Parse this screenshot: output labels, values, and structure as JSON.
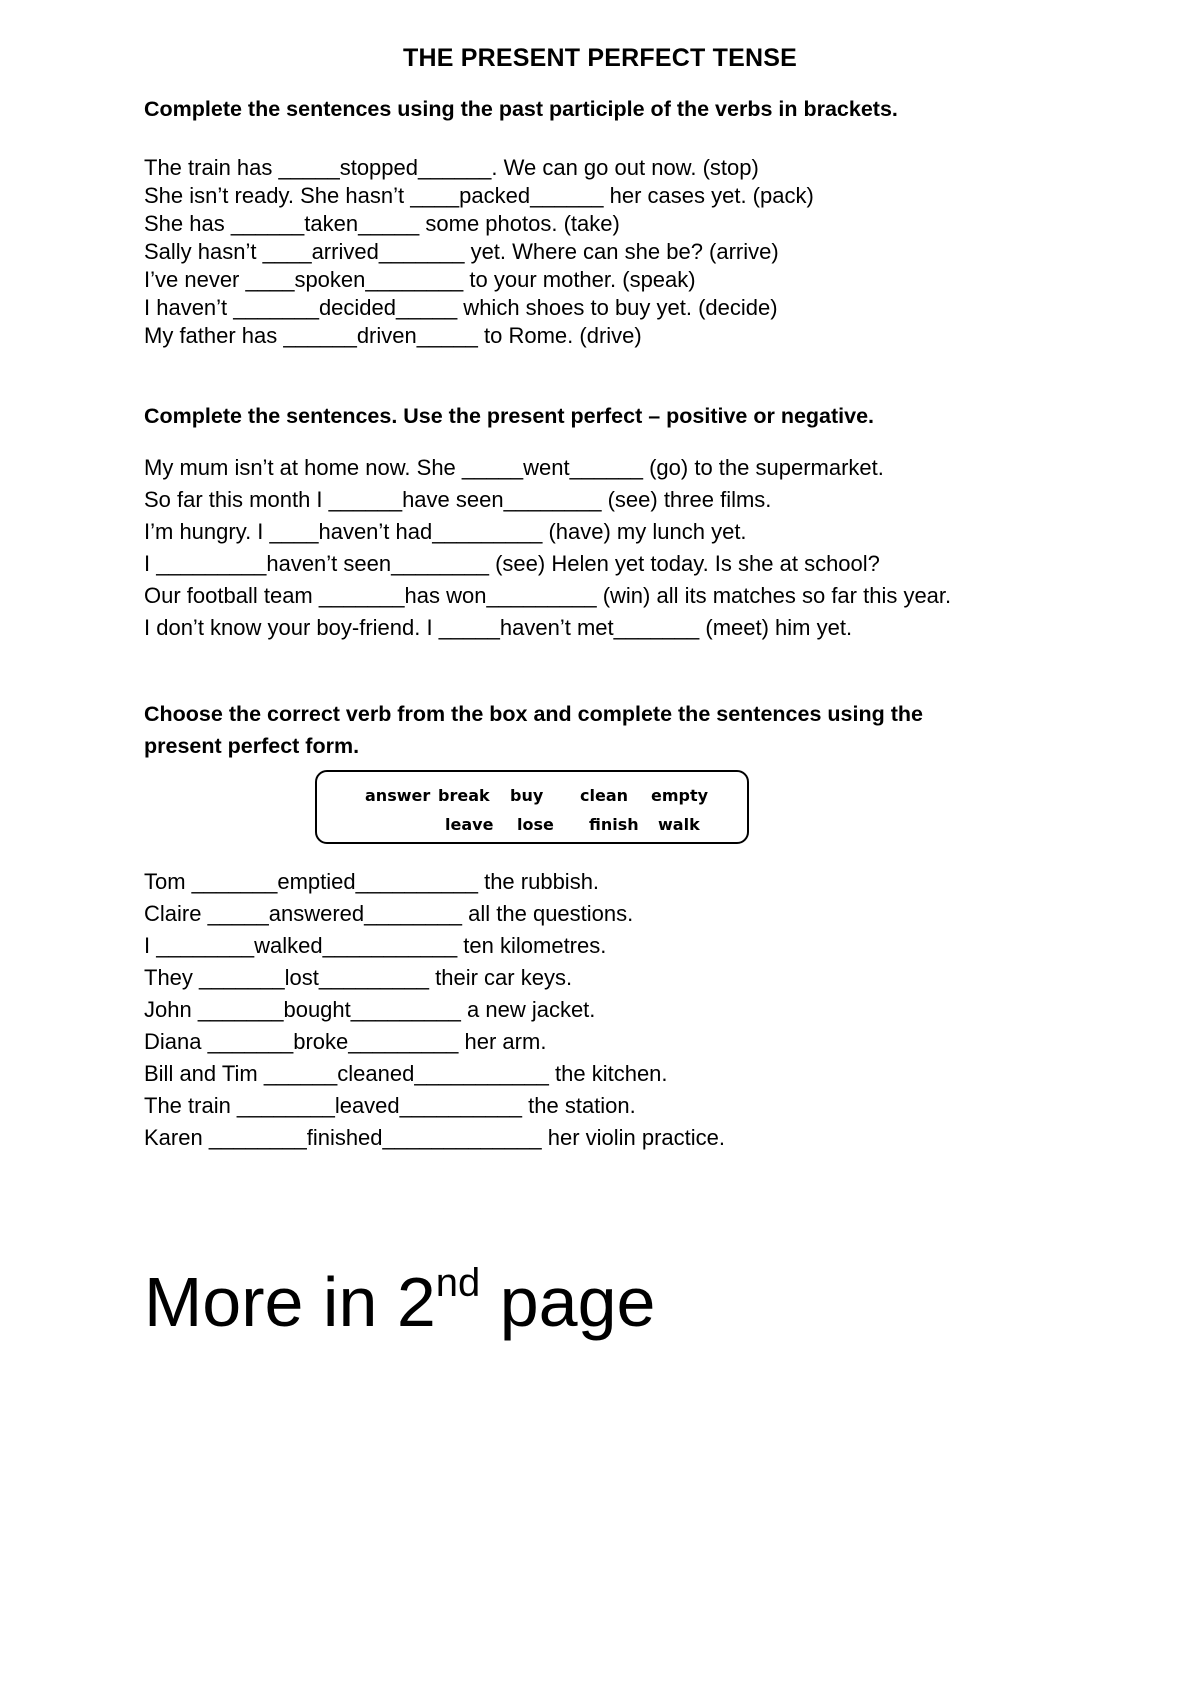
{
  "title": "THE PRESENT PERFECT TENSE",
  "section1": {
    "instruction": "Complete the sentences using the past participle of the verbs in brackets.",
    "items": [
      {
        "before": "The train has _____",
        "answer": "stopped",
        "after": "______. We can go out now. (stop)"
      },
      {
        "before": "She isn’t ready. She hasn’t ____",
        "answer": "packed",
        "after": "______ her cases yet. (pack)"
      },
      {
        "before": "She has ______",
        "answer": "taken",
        "after": "_____ some photos. (take)"
      },
      {
        "before": "Sally hasn’t ____",
        "answer": "arrived",
        "after": "_______ yet. Where can she be? (arrive)"
      },
      {
        "before": "I’ve never ____",
        "answer": "spoken",
        "after": "________ to your mother. (speak)"
      },
      {
        "before": "I haven’t _______",
        "answer": "decided",
        "after": "_____ which shoes to buy yet. (decide)"
      },
      {
        "before": "My father has ______",
        "answer": "driven",
        "after": "_____ to Rome. (drive)"
      }
    ]
  },
  "section2": {
    "instruction": "Complete the sentences. Use the present perfect – positive or negative.",
    "items": [
      {
        "before": "My mum isn’t at home now. She _____",
        "answer": "went",
        "after": "______ (go) to the supermarket."
      },
      {
        "before": "So far this month I ______",
        "answer": "have seen",
        "after": "________ (see) three films."
      },
      {
        "before": "I’m hungry. I ____",
        "answer": "haven’t had",
        "after": "_________ (have) my lunch yet."
      },
      {
        "before": "I _________",
        "answer": "haven’t seen",
        "after": "________ (see) Helen yet today. Is she at school?"
      },
      {
        "before": "Our football team _______",
        "answer": "has won",
        "after": "_________ (win) all its matches so far this year."
      },
      {
        "before": "I don’t know your boy-friend. I _____",
        "answer": "haven’t met",
        "after": "_______ (meet) him yet."
      }
    ]
  },
  "section3": {
    "instruction_line1": "Choose the correct verb from the box and complete the sentences using the",
    "instruction_line2": "present perfect form.",
    "word_box": {
      "row1": [
        "answer",
        "break",
        "buy",
        "clean",
        "empty"
      ],
      "row2": [
        "leave",
        "lose",
        "finish",
        "walk"
      ]
    },
    "items": [
      {
        "before": "Tom _______",
        "answer": "emptied",
        "after": "__________ the rubbish."
      },
      {
        "before": "Claire _____",
        "answer": "answered",
        "after": "________ all the questions."
      },
      {
        "before": "I ________",
        "answer": "walked",
        "after": "___________ ten kilometres."
      },
      {
        "before": "They _______",
        "answer": "lost",
        "after": "_________ their car keys."
      },
      {
        "before": "John _______",
        "answer": "bought",
        "after": "_________ a new jacket."
      },
      {
        "before": "Diana _______",
        "answer": "broke",
        "after": "_________ her arm."
      },
      {
        "before": "Bill and Tim ______",
        "answer": "cleaned",
        "after": "___________ the kitchen."
      },
      {
        "before": "The train ________",
        "answer": "leaved",
        "after": "__________ the station."
      },
      {
        "before": "Karen ________",
        "answer": "finished",
        "after": "_____________ her violin practice."
      }
    ]
  },
  "footer": {
    "text_before": "More in 2",
    "superscript": "nd",
    "text_after": " page"
  }
}
